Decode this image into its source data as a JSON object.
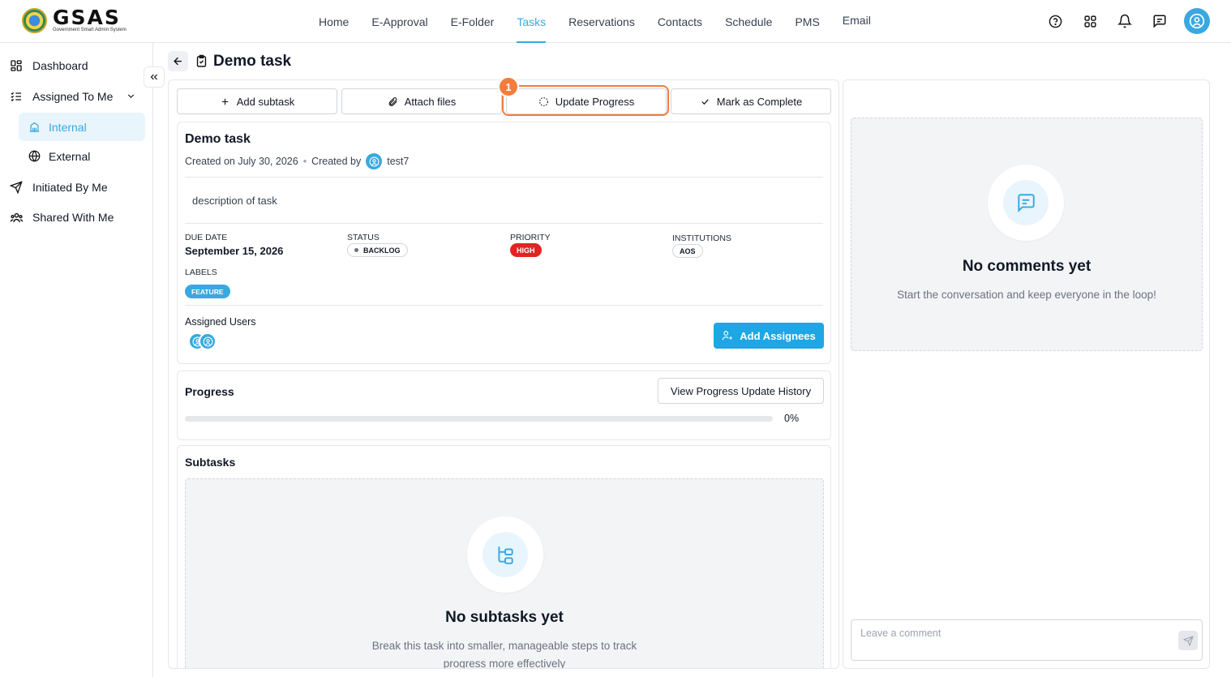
{
  "app": {
    "brand_name": "GSAS",
    "brand_subtitle": "Government Smart Admin System"
  },
  "nav": {
    "items": [
      "Home",
      "E-Approval",
      "E-Folder",
      "Tasks",
      "Reservations",
      "Contacts",
      "Schedule",
      "PMS",
      "Email"
    ],
    "active": "Tasks"
  },
  "top_icons": [
    "help-circle-icon",
    "apps-grid-icon",
    "bell-icon",
    "chat-icon",
    "user-avatar-icon"
  ],
  "sidebar": {
    "dashboard": "Dashboard",
    "assigned_to_me": "Assigned To Me",
    "internal": "Internal",
    "external": "External",
    "initiated_by_me": "Initiated By Me",
    "shared_with_me": "Shared With Me",
    "active": "Internal"
  },
  "page": {
    "title": "Demo task"
  },
  "actions": {
    "add_subtask": "Add subtask",
    "attach_files": "Attach files",
    "update_progress": "Update Progress",
    "mark_complete": "Mark as Complete",
    "step_badge": "1"
  },
  "task": {
    "title": "Demo task",
    "created_on": "Created on July 30, 2026",
    "created_by_label": "Created by",
    "created_by_user": "test7",
    "description": "description of task",
    "due_date_label": "DUE DATE",
    "due_date": "September 15, 2026",
    "status_label": "STATUS",
    "status": "BACKLOG",
    "priority_label": "PRIORITY",
    "priority": "HIGH",
    "institutions_label": "INSTITUTIONS",
    "institution": "AOS",
    "labels_label": "LABELS",
    "label": "FEATURE",
    "assigned_users_label": "Assigned Users",
    "add_assignees": "Add Assignees"
  },
  "progress": {
    "title": "Progress",
    "history_button": "View Progress Update History",
    "value_text": "0%",
    "value": 0
  },
  "subtasks": {
    "title": "Subtasks",
    "empty_title": "No subtasks yet",
    "empty_text_1": "Break this task into smaller, manageable steps to track",
    "empty_text_2": "progress more effectively"
  },
  "comments": {
    "empty_title": "No comments yet",
    "empty_text": "Start the conversation and keep everyone in the loop!",
    "placeholder": "Leave a comment"
  },
  "colors": {
    "accent": "#38a9e0",
    "highlight": "#f47c3c",
    "priority_high": "#e02424"
  }
}
